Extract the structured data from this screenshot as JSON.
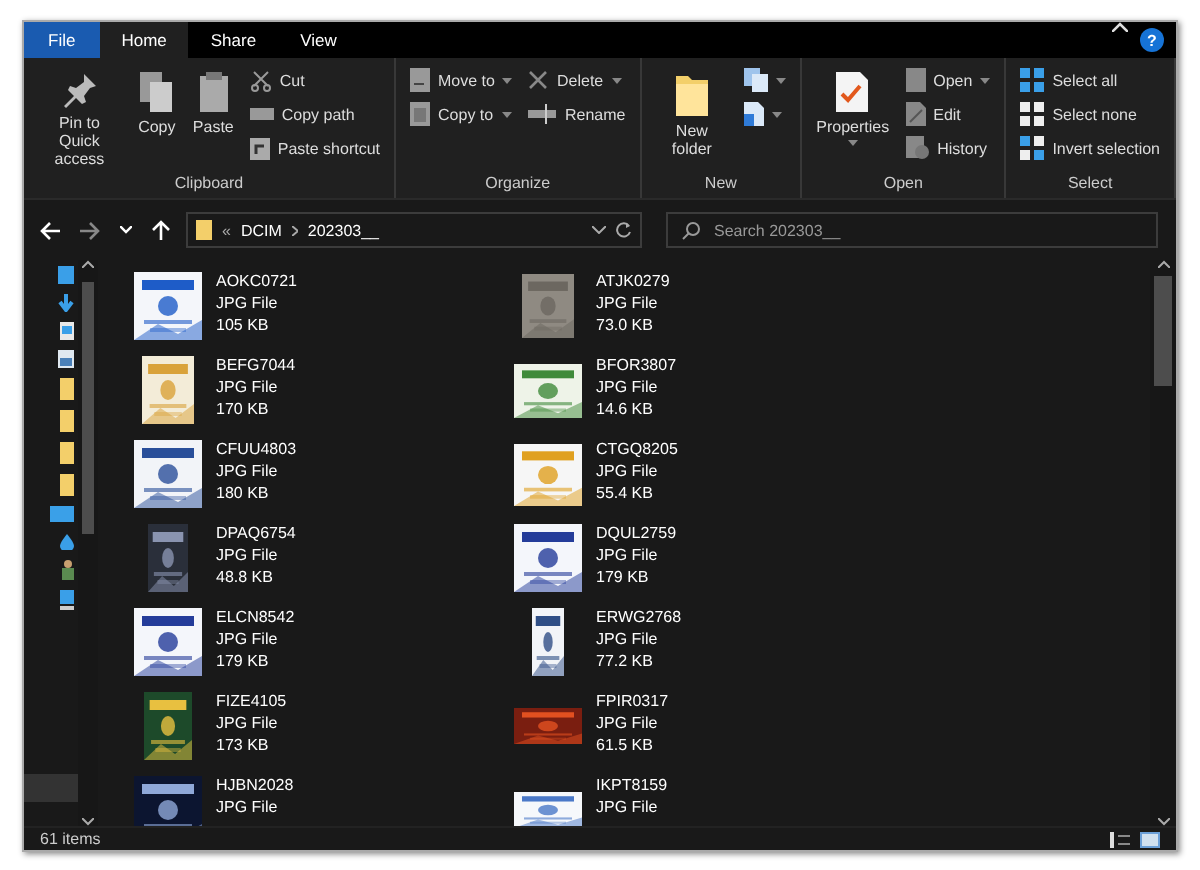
{
  "tabs": [
    {
      "label": "File",
      "kind": "file",
      "selected": false
    },
    {
      "label": "Home",
      "kind": "tab",
      "selected": true
    },
    {
      "label": "Share",
      "kind": "tab",
      "selected": false
    },
    {
      "label": "View",
      "kind": "tab",
      "selected": false
    }
  ],
  "help": "?",
  "ribbon": [
    {
      "label": "Clipboard",
      "items": [
        {
          "kind": "big",
          "label": "Pin to Quick access"
        },
        {
          "kind": "big",
          "label": "Copy"
        },
        {
          "kind": "big",
          "label": "Paste"
        },
        {
          "kind": "stack",
          "items": [
            {
              "label": "Cut"
            },
            {
              "label": "Copy path"
            },
            {
              "label": "Paste shortcut"
            }
          ]
        }
      ]
    },
    {
      "label": "Organize",
      "items": [
        {
          "kind": "stack",
          "items": [
            {
              "label": "Move to",
              "dropdown": true
            },
            {
              "label": "Copy to",
              "dropdown": true
            }
          ]
        },
        {
          "kind": "stack",
          "items": [
            {
              "label": "Delete",
              "dropdown": true
            },
            {
              "label": "Rename"
            }
          ]
        }
      ]
    },
    {
      "label": "New",
      "items": [
        {
          "kind": "big",
          "label": "New folder"
        },
        {
          "kind": "stack",
          "items": [
            {
              "dropdown": true
            },
            {
              "dropdown": true
            }
          ]
        }
      ]
    },
    {
      "label": "Open",
      "items": [
        {
          "kind": "big",
          "label": "Properties",
          "dropdown": true
        },
        {
          "kind": "stack",
          "items": [
            {
              "label": "Open",
              "dropdown": true
            },
            {
              "label": "Edit"
            },
            {
              "label": "History"
            }
          ]
        }
      ]
    },
    {
      "label": "Select",
      "items": [
        {
          "kind": "stack",
          "items": [
            {
              "label": "Select all"
            },
            {
              "label": "Select none"
            },
            {
              "label": "Invert selection"
            }
          ]
        }
      ]
    }
  ],
  "address": {
    "overflow": "«",
    "path": [
      "DCIM",
      "202303__"
    ]
  },
  "search": {
    "placeholder": "Search 202303__"
  },
  "files": [
    {
      "name": "AOKC0721",
      "type": "JPG File",
      "size": "105 KB"
    },
    {
      "name": "ATJK0279",
      "type": "JPG File",
      "size": "73.0 KB"
    },
    {
      "name": "BEFG7044",
      "type": "JPG File",
      "size": "170 KB"
    },
    {
      "name": "BFOR3807",
      "type": "JPG File",
      "size": "14.6 KB"
    },
    {
      "name": "CFUU4803",
      "type": "JPG File",
      "size": "180 KB"
    },
    {
      "name": "CTGQ8205",
      "type": "JPG File",
      "size": "55.4 KB"
    },
    {
      "name": "DPAQ6754",
      "type": "JPG File",
      "size": "48.8 KB"
    },
    {
      "name": "DQUL2759",
      "type": "JPG File",
      "size": "179 KB"
    },
    {
      "name": "ELCN8542",
      "type": "JPG File",
      "size": "179 KB"
    },
    {
      "name": "ERWG2768",
      "type": "JPG File",
      "size": "77.2 KB"
    },
    {
      "name": "FIZE4105",
      "type": "JPG File",
      "size": "173 KB"
    },
    {
      "name": "FPIR0317",
      "type": "JPG File",
      "size": "61.5 KB"
    },
    {
      "name": "HJBN2028",
      "type": "JPG File"
    },
    {
      "name": "IKPT8159",
      "type": "JPG File"
    }
  ],
  "status_bar": {
    "count": "61 items"
  }
}
